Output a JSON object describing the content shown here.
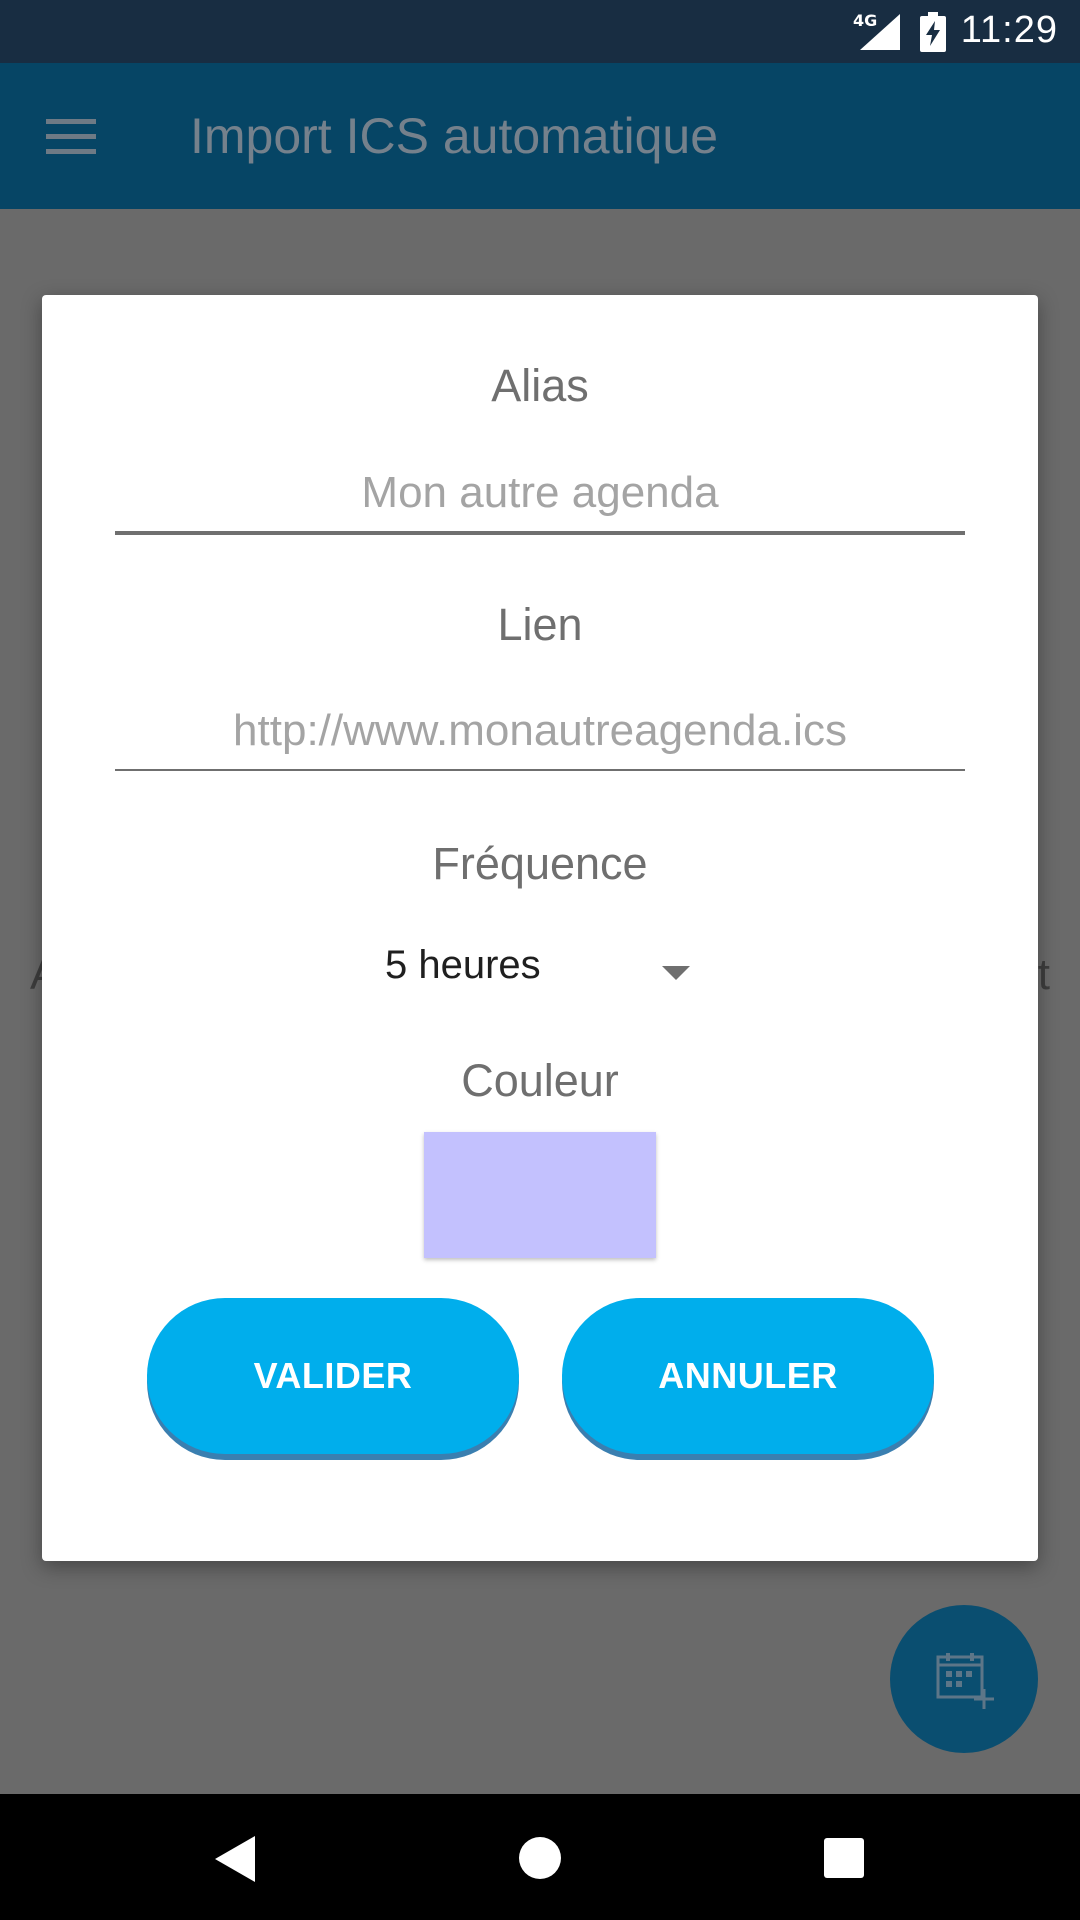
{
  "status_bar": {
    "network_label": "4G",
    "time": "11:29",
    "icons": [
      "signal-icon",
      "battery-charging-icon"
    ]
  },
  "app_bar": {
    "title": "Import ICS automatique",
    "menu_icon": "hamburger-menu-icon"
  },
  "background": {
    "left_text": "A",
    "right_text": "t"
  },
  "dialog": {
    "alias": {
      "label": "Alias",
      "value": "",
      "placeholder": "Mon autre agenda"
    },
    "link": {
      "label": "Lien",
      "value": "",
      "placeholder": "http://www.monautreagenda.ics"
    },
    "frequency": {
      "label": "Fréquence",
      "selected": "5 heures"
    },
    "color": {
      "label": "Couleur",
      "value": "#c3c1fe"
    },
    "buttons": {
      "validate": "VALIDER",
      "cancel": "ANNULER"
    }
  },
  "fab": {
    "icon": "calendar-add-icon"
  },
  "nav_bar": {
    "icons": [
      "back-icon",
      "home-icon",
      "recents-icon"
    ]
  },
  "colors": {
    "status_bar": "#182d42",
    "app_bar": "#064565",
    "accent_button": "#00aeec",
    "scrim": "#6a6a6a"
  }
}
